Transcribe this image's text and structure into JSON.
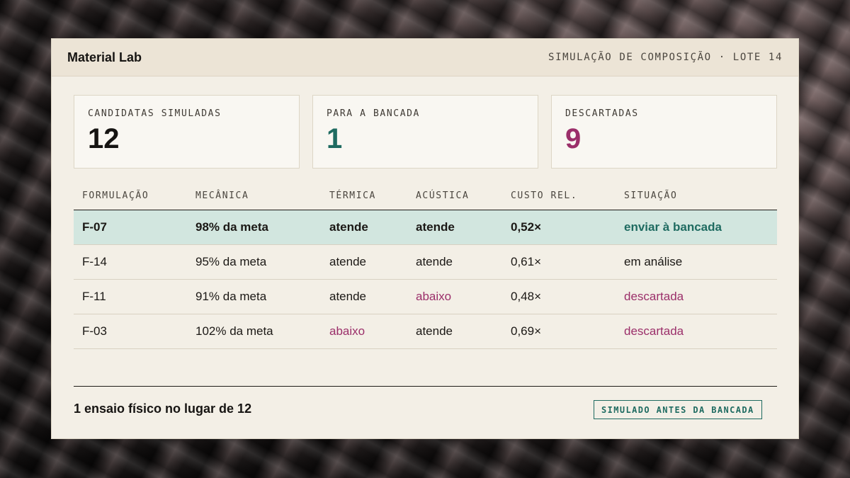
{
  "header": {
    "brand": "Material Lab",
    "subtitle": "SIMULAÇÃO DE COMPOSIÇÃO · LOTE 14"
  },
  "stats": [
    {
      "label": "CANDIDATAS SIMULADAS",
      "value": "12",
      "color": "#161412"
    },
    {
      "label": "PARA A BANCADA",
      "value": "1",
      "color": "#1f6b61"
    },
    {
      "label": "DESCARTADAS",
      "value": "9",
      "color": "#9b2f6a"
    }
  ],
  "table": {
    "columns": [
      "FORMULAÇÃO",
      "MECÂNICA",
      "TÉRMICA",
      "ACÚSTICA",
      "CUSTO REL.",
      "SITUAÇÃO"
    ],
    "rows": [
      {
        "formulacao": "F-07",
        "mecanica": "98% da meta",
        "termica": "atende",
        "acustica": "atende",
        "custo": "0,52×",
        "situacao": "enviar à bancada"
      },
      {
        "formulacao": "F-14",
        "mecanica": "95% da meta",
        "termica": "atende",
        "acustica": "atende",
        "custo": "0,61×",
        "situacao": "em análise"
      },
      {
        "formulacao": "F-11",
        "mecanica": "91% da meta",
        "termica": "atende",
        "acustica": "abaixo",
        "custo": "0,48×",
        "situacao": "descartada"
      },
      {
        "formulacao": "F-03",
        "mecanica": "102% da meta",
        "termica": "abaixo",
        "acustica": "atende",
        "custo": "0,69×",
        "situacao": "descartada"
      }
    ]
  },
  "footer": {
    "summary": "1 ensaio físico no lugar de 12",
    "badge": "SIMULADO ANTES DA BANCADA"
  },
  "colors": {
    "accent_teal": "#1f6b61",
    "accent_magenta": "#9b2f6a",
    "highlight_row": "#d2e6df"
  }
}
